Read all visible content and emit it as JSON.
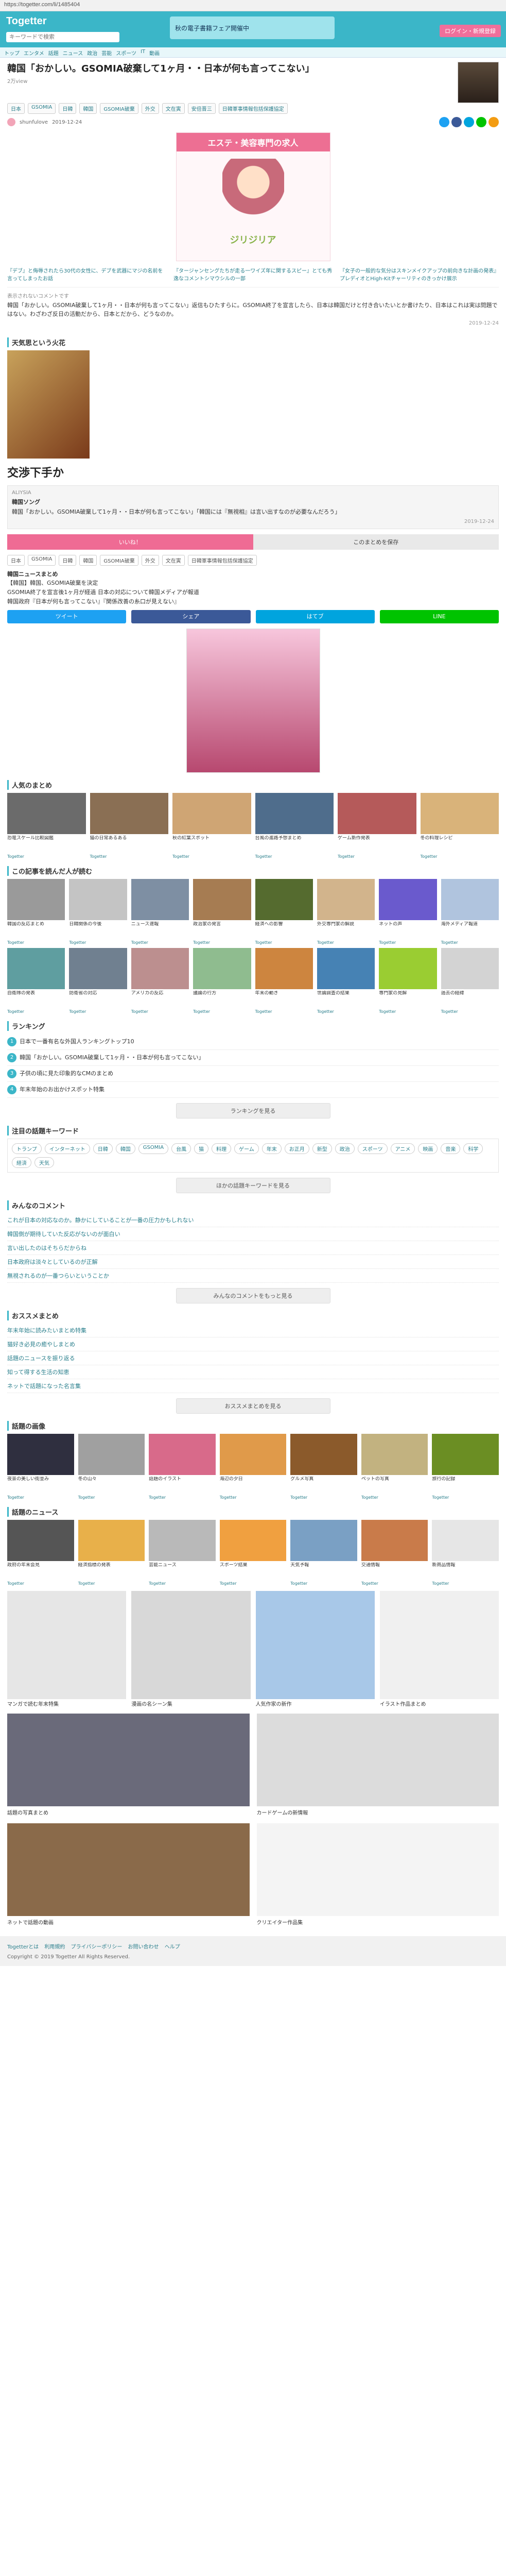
{
  "url": "https://togetter.com/li/1485404",
  "header": {
    "logo": "Togetter",
    "search_placeholder": "キーワードで検索",
    "banner": "秋の電子書籍フェア開催中",
    "login": "ログイン・新規登録"
  },
  "nav": [
    "トップ",
    "エンタメ",
    "話題",
    "ニュース",
    "政治",
    "芸能",
    "スポーツ",
    "IT",
    "動画"
  ],
  "article": {
    "title": "韓国「おかしい。GSOMIA破棄して1ヶ月・・日本が何も言ってこない」",
    "views": "2万view",
    "tags": [
      "日本",
      "GSOMIA",
      "日韓",
      "韓国",
      "GSOMIA破棄",
      "外交",
      "文在寅",
      "安倍晋三",
      "日韓軍事情報包括保護協定"
    ],
    "author": "shunfulove",
    "date": "2019-12-24",
    "related": [
      "『デブ』と侮辱されたら30代の女性に、デブを武器にマジの名前を言ってしまったお話",
      "『タージャンセングたちが走る一ワイズ年に関するスピー』とても秀逸なコメントシマウシルの一部",
      "『女子の一般的な気分はスキンメイクアップの前向きな計画の発表』プレディオとHigh-Kitチャーリティのきっかけ展示"
    ]
  },
  "ad": {
    "top": "エステ・美容専門の求人",
    "brand": "ジリジリア"
  },
  "comments": [
    {
      "head": "表示されないコメントです",
      "body": "韓国「おかしい。GSOMIA破棄して1ヶ月・・日本が何も言ってこない」返信もひたすらに。GSOMIA終了を宣言したら、日本は韓国だけと付き合いたいとか書けたり、日本はこれは実は問題ではない。わざわざ反日の活動だから、日本とだから、どうなのか。",
      "votes": "2019-12-24"
    }
  ],
  "book_section": "天気思という火花",
  "big_text": "交渉下手か",
  "reply": {
    "user": "ALIYSIA",
    "label": "韓国ソング",
    "body": "韓国「おかしい。GSOMIA破棄して1ヶ月・・日本が何も言ってこない」「韓国には『無視相』は言い出すなのが必要なんだろう」",
    "date": "2019-12-24"
  },
  "actions": {
    "like": "いいね！",
    "save": "このまとめを保存"
  },
  "chips": [
    "日本",
    "GSOMIA",
    "日韓",
    "韓国",
    "GSOMIA破棄",
    "外交",
    "文在寅",
    "日韓軍事情報包括保護協定"
  ],
  "source": {
    "heading": "韓国ニュースまとめ",
    "lines": [
      "【韓国】韓国、GSOMIA破棄を決定",
      "GSOMIA終了を宣言後1ヶ月が経過 日本の対応について韓国メディアが報道",
      "韓国政府『日本が何も言ってこない』『関係改善の糸口が見えない』"
    ]
  },
  "sharebar": [
    "ツイート",
    "シェア",
    "はてブ",
    "LINE"
  ],
  "sections": {
    "popular": "人気のまとめ",
    "recommend": "この記事を読んだ人が読む",
    "more": "もっと読む",
    "ranking": "ランキング",
    "ranking_more": "ランキングを見る",
    "keywords": "注目の話題キーワード",
    "keywords_more": "ほかの話題キーワードを見る",
    "comments": "みんなのコメント",
    "comments_more": "みんなのコメントをもっと見る",
    "matome": "おススメまとめ",
    "matome_more": "おススメまとめを見る",
    "videos": "話題の画像",
    "news": "話題のニュース"
  },
  "popular": [
    {
      "cap": "恐竜スケール比較図鑑",
      "src": "Togetter"
    },
    {
      "cap": "猫の日常あるある",
      "src": "Togetter"
    },
    {
      "cap": "秋の紅葉スポット",
      "src": "Togetter"
    },
    {
      "cap": "台風の進路予想まとめ",
      "src": "Togetter"
    },
    {
      "cap": "ゲーム新作発表",
      "src": "Togetter"
    },
    {
      "cap": "冬の料理レシピ",
      "src": "Togetter"
    }
  ],
  "recommend": [
    {
      "cap": "韓国の反応まとめ",
      "src": "Togetter"
    },
    {
      "cap": "日韓関係の今後",
      "src": "Togetter"
    },
    {
      "cap": "ニュース速報",
      "src": "Togetter"
    },
    {
      "cap": "政治家の発言",
      "src": "Togetter"
    },
    {
      "cap": "経済への影響",
      "src": "Togetter"
    },
    {
      "cap": "外交専門家の解説",
      "src": "Togetter"
    },
    {
      "cap": "ネットの声",
      "src": "Togetter"
    },
    {
      "cap": "海外メディア報道",
      "src": "Togetter"
    }
  ],
  "recommend2": [
    {
      "cap": "自衛隊の発表",
      "src": "Togetter"
    },
    {
      "cap": "防衛省の対応",
      "src": "Togetter"
    },
    {
      "cap": "アメリカの反応",
      "src": "Togetter"
    },
    {
      "cap": "議論の行方",
      "src": "Togetter"
    },
    {
      "cap": "年末の動き",
      "src": "Togetter"
    },
    {
      "cap": "世論調査の結果",
      "src": "Togetter"
    },
    {
      "cap": "専門家の見解",
      "src": "Togetter"
    },
    {
      "cap": "過去の経緯",
      "src": "Togetter"
    }
  ],
  "ranking": [
    {
      "num": "1",
      "text": "日本で一番有名な外国人ランキングトップ10"
    },
    {
      "num": "2",
      "text": "韓国「おかしい。GSOMIA破棄して1ヶ月・・日本が何も言ってこない」"
    },
    {
      "num": "3",
      "text": "子供の頃に見た印象的なCMのまとめ"
    },
    {
      "num": "4",
      "text": "年末年始のお出かけスポット特集"
    }
  ],
  "keywords": [
    "トランプ",
    "インターネット",
    "日韓",
    "韓国",
    "GSOMIA",
    "台風",
    "猫",
    "料理",
    "ゲーム",
    "年末",
    "お正月",
    "新型",
    "政治",
    "スポーツ",
    "アニメ",
    "映画",
    "音楽",
    "科学",
    "経済",
    "天気"
  ],
  "user_comments": [
    "これが日本の対応なのか。静かにしていることが一番の圧力かもしれない",
    "韓国側が期待していた反応がないのが面白い",
    "言い出したのはそちらだからね",
    "日本政府は淡々としているのが正解",
    "無視されるのが一番つらいということか"
  ],
  "matome": [
    "年末年始に読みたいまとめ特集",
    "猫好き必見の癒やしまとめ",
    "話題のニュースを振り返る",
    "知って得する生活の知恵",
    "ネットで話題になった名言集"
  ],
  "images": [
    {
      "cap": "夜景の美しい街並み",
      "src": "Togetter"
    },
    {
      "cap": "冬の山々",
      "src": "Togetter"
    },
    {
      "cap": "話題のイラスト",
      "src": "Togetter"
    },
    {
      "cap": "海辺の夕日",
      "src": "Togetter"
    },
    {
      "cap": "グルメ写真",
      "src": "Togetter"
    },
    {
      "cap": "ペットの写真",
      "src": "Togetter"
    },
    {
      "cap": "旅行の記録",
      "src": "Togetter"
    }
  ],
  "news": [
    {
      "cap": "政府の年末会見",
      "src": "Togetter"
    },
    {
      "cap": "経済指標の発表",
      "src": "Togetter"
    },
    {
      "cap": "芸能ニュース",
      "src": "Togetter"
    },
    {
      "cap": "スポーツ結果",
      "src": "Togetter"
    },
    {
      "cap": "天気予報",
      "src": "Togetter"
    },
    {
      "cap": "交通情報",
      "src": "Togetter"
    },
    {
      "cap": "新商品情報",
      "src": "Togetter"
    }
  ],
  "big_cards": [
    {
      "cap": "マンガで読む年末特集"
    },
    {
      "cap": "漫画の名シーン集"
    },
    {
      "cap": "人気作家の新作"
    },
    {
      "cap": "イラスト作品まとめ"
    }
  ],
  "pair_cards": [
    {
      "cap": "話題の写真まとめ"
    },
    {
      "cap": "カードゲームの新情報"
    },
    {
      "cap": "ネットで話題の動画"
    },
    {
      "cap": "クリエイター作品集"
    }
  ],
  "footer": {
    "links": [
      "Togetterとは",
      "利用規約",
      "プライバシーポリシー",
      "お問い合わせ",
      "ヘルプ"
    ],
    "copy": "Copyright © 2019 Togetter All Rights Reserved."
  }
}
